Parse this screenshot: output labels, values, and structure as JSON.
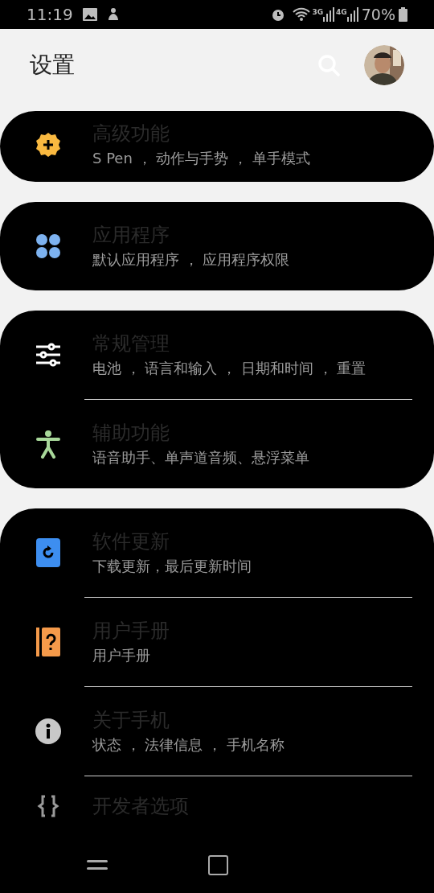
{
  "status_bar": {
    "time": "11:19",
    "network_labels": [
      "3G",
      "4G"
    ],
    "battery": "70%"
  },
  "header": {
    "title": "设置"
  },
  "groups": [
    {
      "items": [
        {
          "kind": "gear",
          "color": "#f9b940",
          "title": "高级功能",
          "subtitle": "S Pen ， 动作与手势 ， 单手模式"
        }
      ]
    },
    {
      "items": [
        {
          "kind": "dots",
          "color": "#7db2f0",
          "title": "应用程序",
          "subtitle": "默认应用程序 ， 应用程序权限"
        }
      ]
    },
    {
      "items": [
        {
          "kind": "sliders",
          "color": "#ffffff",
          "title": "常规管理",
          "subtitle": "电池 ， 语言和输入 ， 日期和时间 ， 重置"
        },
        {
          "kind": "person",
          "color": "#a8d89a",
          "title": "辅助功能",
          "subtitle": "语音助手、单声道音频、悬浮菜单"
        }
      ]
    },
    {
      "items": [
        {
          "kind": "update",
          "color": "#3d8ef0",
          "title": "软件更新",
          "subtitle": "下载更新，最后更新时间"
        },
        {
          "kind": "manual",
          "color": "#f59a4a",
          "title": "用户手册",
          "subtitle": "用户手册"
        },
        {
          "kind": "info",
          "color": "#c8c8c8",
          "title": "关于手机",
          "subtitle": "状态 ， 法律信息 ， 手机名称"
        },
        {
          "kind": "braces",
          "color": "#9a9a9a",
          "title": "开发者选项"
        }
      ]
    }
  ]
}
